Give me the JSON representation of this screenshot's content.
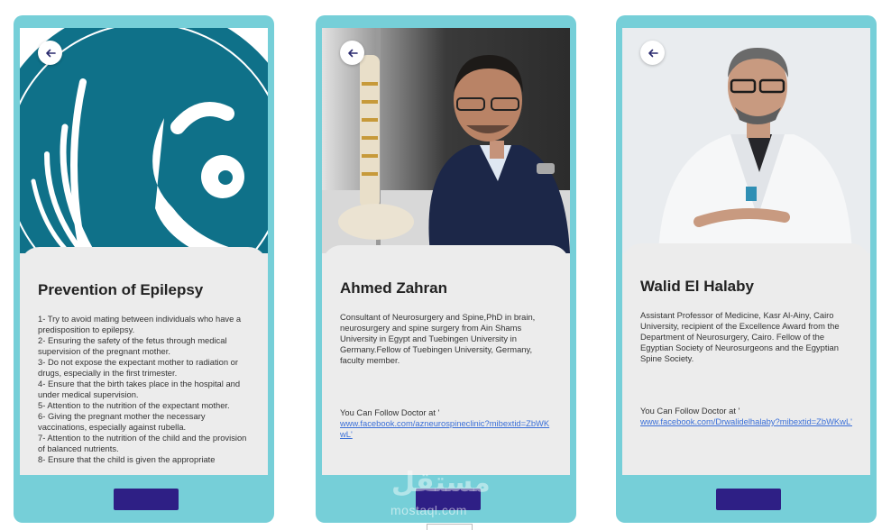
{
  "cards": [
    {
      "title": "Prevention of Epilepsy",
      "lines": [
        "1- Try to avoid mating between individuals who have a predisposition to epilepsy.",
        "2- Ensuring the safety of the fetus through medical supervision of the pregnant mother.",
        "3- Do not expose the expectant mother to radiation or drugs, especially in the first trimester.",
        "4- Ensure that the birth takes place in the hospital and under medical supervision.",
        "5- Attention to the nutrition of the expectant mother.",
        "6- Giving the pregnant mother the necessary vaccinations, especially against rubella.",
        "7- Attention to the nutrition of the child and the provision of balanced nutrients.",
        "8- Ensure that the child is given the appropriate"
      ]
    },
    {
      "title": "Ahmed Zahran",
      "description": "Consultant of Neurosurgery and Spine,PhD in brain, neurosurgery and spine surgery from Ain Shams University in Egypt and Tuebingen University in Germany.Fellow of Tuebingen University, Germany, faculty member.",
      "follow_label": "You Can Follow Doctor at '",
      "link": "www.facebook.com/azneurospineclinic?mibextid=ZbWKwL'"
    },
    {
      "title": "Walid El Halaby",
      "description": "Assistant Professor of Medicine, Kasr Al-Ainy, Cairo University, recipient of the Excellence Award from the Department of Neurosurgery, Cairo. Fellow of the Egyptian Society of Neurosurgeons and the Egyptian Spine Society.",
      "follow_label": "You Can Follow Doctor at '",
      "link": "www.facebook.com/Drwalidelhalaby?mibextid=ZbWKwL'"
    }
  ],
  "watermark": {
    "logo": "مستقل",
    "text": "mostaql.com"
  },
  "colors": {
    "frame": "#76cfd8",
    "button": "#2e1f85",
    "link": "#3a6fd8",
    "logo_teal": "#0f7189"
  },
  "icons": {
    "back": "arrow-left-icon"
  }
}
